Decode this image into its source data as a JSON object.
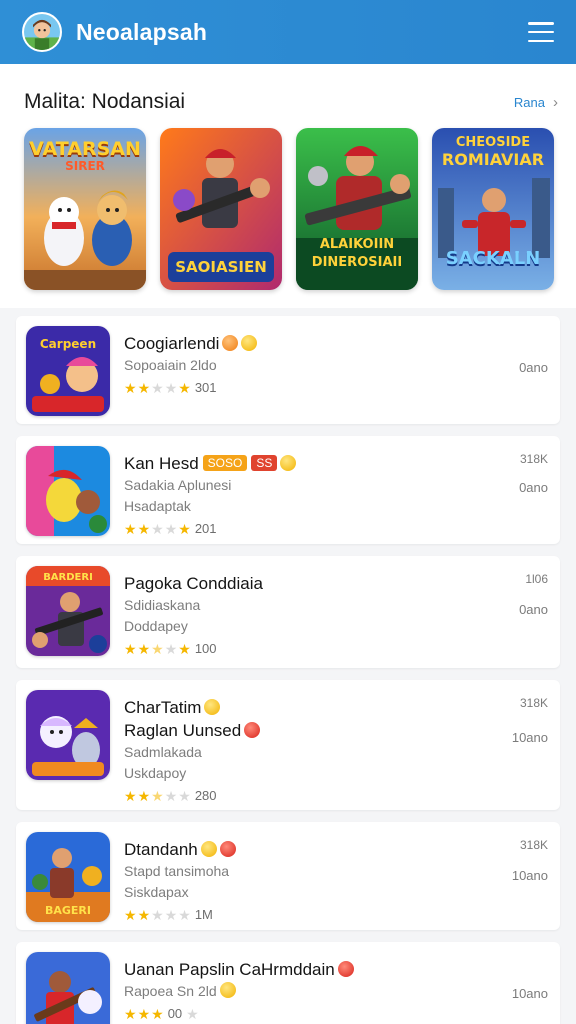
{
  "header": {
    "title": "Neoalapsah",
    "logo_icon": "avatar-logo-icon",
    "menu_icon": "hamburger-menu-icon"
  },
  "featured": {
    "title": "Malita: Nodansiai",
    "see_all": "Rana",
    "banners": [
      {
        "top": "VATARSAN",
        "top2": "SIRER",
        "bottom": ""
      },
      {
        "top": "",
        "top2": "",
        "bottom": "SAOIASIEN"
      },
      {
        "top": "",
        "top2": "",
        "bottom": "ALAIKOIIN",
        "bottom2": "DINEROSIAII"
      },
      {
        "top": "CHEOSIDE",
        "top2": "ROMIAVIAR",
        "bottom": "SACKALN"
      }
    ]
  },
  "games": [
    {
      "name": "Coogiarlendi",
      "line2": "",
      "sub1": "Sopoaiain 2ldo",
      "sub2": "",
      "rating_text": "301",
      "stars": 2,
      "meta_top": "",
      "meta_mid": "0ano"
    },
    {
      "name": "Kan Hesd",
      "tag1": "SOSO",
      "tag2": "SS",
      "line2": "",
      "sub1": "Sadakia Aplunesi",
      "sub2": "Hsadaptak",
      "rating_text": "201",
      "stars": 2,
      "meta_top": "318K",
      "meta_mid": "0ano"
    },
    {
      "name": "Pagoka Conddiaia",
      "line2": "",
      "sub1": "Sdidiaskana",
      "sub2": "Doddapey",
      "rating_text": "100",
      "stars": 2.5,
      "meta_top": "1l06",
      "meta_mid": "0ano"
    },
    {
      "name": "CharTatim",
      "line2": "Raglan Uunsed",
      "sub1": "Sadmlakada",
      "sub2": "Uskdapoy",
      "rating_text": "280",
      "stars": 2.5,
      "meta_top": "318K",
      "meta_mid": "10ano"
    },
    {
      "name": "Dtandanh",
      "line2": "",
      "sub1": "Stapd tansimoha",
      "sub2": "Siskdapax",
      "rating_text": "1M",
      "stars": 2,
      "meta_top": "318K",
      "meta_mid": "10ano"
    },
    {
      "name": "Uanan Papslin CaHrmddain",
      "line2": "",
      "sub1": "Rapoea Sn 2ld",
      "sub2": "",
      "rating_text": "00",
      "stars": 3,
      "meta_top": "",
      "meta_mid": "10ano"
    }
  ]
}
